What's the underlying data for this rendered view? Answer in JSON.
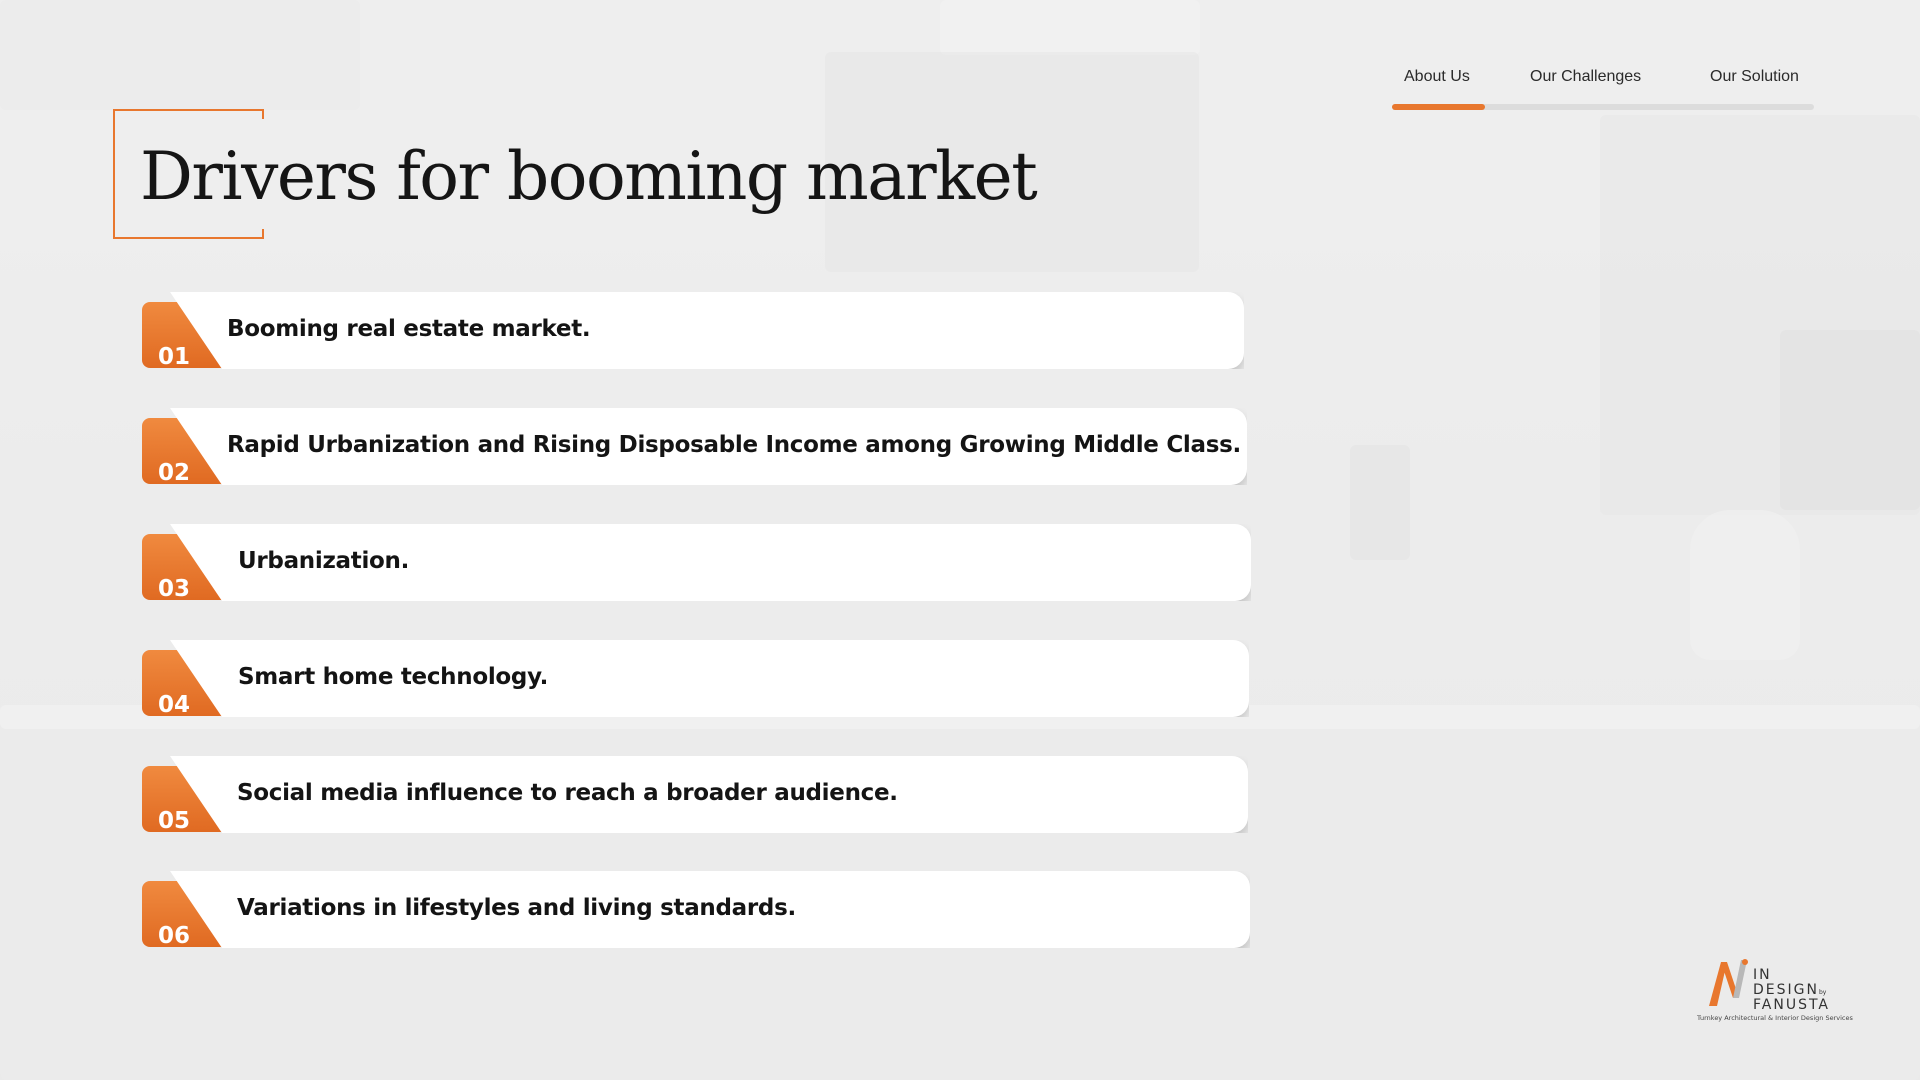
{
  "colors": {
    "accent": "#e8772e",
    "card": "#ffffff",
    "text": "#141414"
  },
  "nav": {
    "tabs": [
      {
        "label": "About Us",
        "active": true
      },
      {
        "label": "Our Challenges",
        "active": false
      },
      {
        "label": "Our Solution",
        "active": false
      }
    ]
  },
  "slide": {
    "title": "Drivers for booming market"
  },
  "drivers": [
    {
      "number": "01",
      "text": "Booming real estate market."
    },
    {
      "number": "02",
      "text": "Rapid Urbanization and Rising Disposable Income among Growing Middle Class."
    },
    {
      "number": "03",
      "text": "Urbanization."
    },
    {
      "number": "04",
      "text": "Smart home technology."
    },
    {
      "number": "05",
      "text": "Social media influence to reach a broader audience."
    },
    {
      "number": "06",
      "text": "Variations in lifestyles and living standards."
    }
  ],
  "logo": {
    "line1": "IN",
    "line2": "DESIGN",
    "by": "by",
    "line3": "FANUSTA",
    "tagline": "Turnkey Architectural & Interior Design Services"
  }
}
